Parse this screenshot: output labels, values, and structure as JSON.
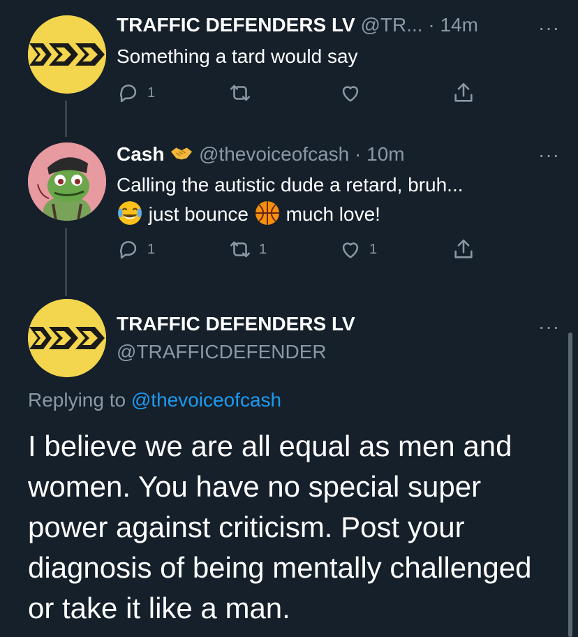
{
  "tweet1": {
    "name": "TRAFFIC DEFENDERS LV",
    "handle": "@TR...",
    "dot": "·",
    "time": "14m",
    "more": "···",
    "text": "Something a tard would say",
    "reply_count": "1",
    "retweet_count": "",
    "like_count": ""
  },
  "tweet2": {
    "name": "Cash",
    "name_emoji": "handshake-emoji",
    "handle": "@thevoiceofcash",
    "dot": "·",
    "time": "10m",
    "more": "···",
    "line1": "Calling the autistic dude a retard, bruh...",
    "line2_part1": "just bounce",
    "line2_part2": "much love!",
    "reply_count": "1",
    "retweet_count": "1",
    "like_count": "1"
  },
  "main_tweet": {
    "name": "TRAFFIC DEFENDERS LV",
    "handle": "@TRAFFICDEFENDER",
    "more": "···",
    "replying_prefix": "Replying to",
    "replying_handle": "@thevoiceofcash",
    "text": "I believe we are all equal as men and women.  You have no special super power against criticism.  Post your diagnosis of being mentally challenged or take it like a man."
  },
  "colors": {
    "background": "#15202b",
    "muted": "#8b98a5",
    "link": "#1d9bf0",
    "avatar_yellow": "#f3d54e"
  }
}
